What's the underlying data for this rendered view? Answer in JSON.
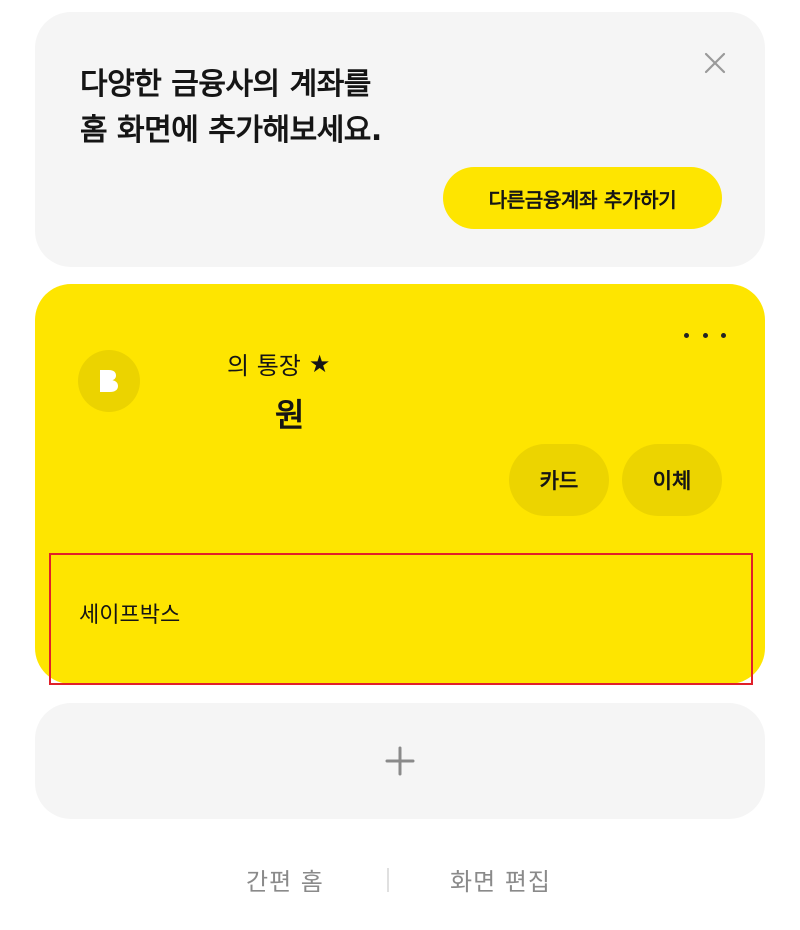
{
  "promo": {
    "line1": "다양한 금융사의 계좌를",
    "line2": "홈 화면에 추가해보세요.",
    "button_label": "다른금융계좌 추가하기",
    "close_icon": "close-icon"
  },
  "account": {
    "logo_letter": "B",
    "name": "의 통장",
    "favorite_icon": "★",
    "balance": "원",
    "card_label": "카드",
    "transfer_label": "이체",
    "safebox_label": "세이프박스"
  },
  "add": {
    "icon": "plus-icon"
  },
  "bottom": {
    "simple_home": "간편 홈",
    "edit_screen": "화면 편집"
  },
  "colors": {
    "accent": "#fee500",
    "card_bg": "#f5f5f5",
    "highlight_border": "#e0202a"
  }
}
